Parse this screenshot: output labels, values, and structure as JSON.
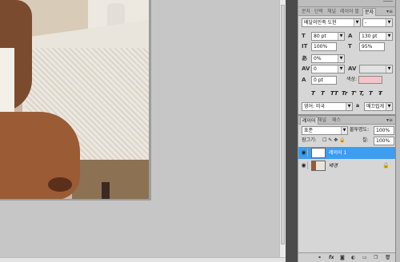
{
  "char_panel": {
    "tabs": [
      "문자",
      "단락",
      "채널",
      "레이어 팔레트",
      "문자"
    ],
    "font_family": "배달의민족 도현",
    "font_style": "-",
    "font_size": "80 pt",
    "leading": "130 pt",
    "vertical_scale": "100%",
    "horizontal_scale": "95%",
    "tsume": "0%",
    "tracking": "0",
    "kerning": "",
    "baseline_shift": "0 pt",
    "color_label": "색상:",
    "color_hex": "#f5c4cb",
    "format_buttons": [
      "T",
      "T",
      "TT",
      "Tr",
      "T'",
      "T,",
      "T",
      "Ŧ"
    ],
    "language": "영어: 미국",
    "antialias_label": "a",
    "antialias": "매끄럽게"
  },
  "layers_panel": {
    "tabs": [
      "레이어",
      "채널",
      "패스"
    ],
    "blend_mode": "표준",
    "opacity_label": "불투명도:",
    "opacity": "100%",
    "lock_label": "잠그기:",
    "fill_label": "칠:",
    "fill": "100%",
    "layers": [
      {
        "name": "레이어 1",
        "selected": true
      },
      {
        "name": "배경",
        "selected": false
      }
    ],
    "bottom_icons": [
      "link-icon",
      "fx-icon",
      "mask-icon",
      "adjustment-icon",
      "group-icon",
      "new-layer-icon",
      "trash-icon"
    ],
    "fx_label": "fx"
  },
  "colors": {
    "selected_layer": "#3c9ef0",
    "panel_bg": "#d6d6d6",
    "canvas_bg": "#c6c6c6"
  }
}
